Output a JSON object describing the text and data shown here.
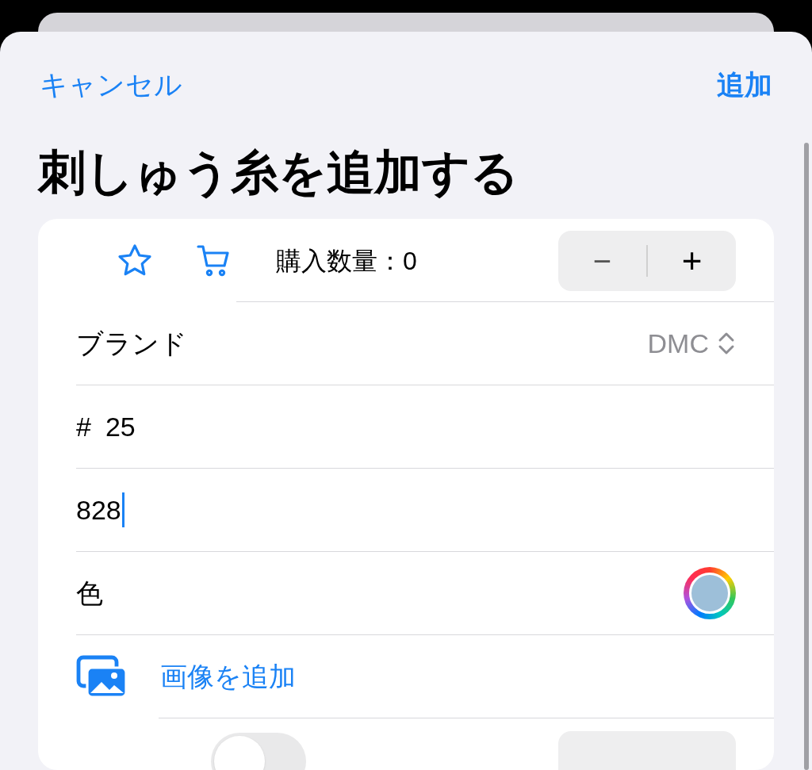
{
  "nav": {
    "cancel": "キャンセル",
    "add": "追加"
  },
  "title": "刺しゅう糸を追加する",
  "purchase": {
    "favorite": false,
    "label": "購入数量：0",
    "minus": "−",
    "plus": "+"
  },
  "brand": {
    "label": "ブランド",
    "value": "DMC"
  },
  "number": {
    "prefix": "#",
    "value": "25"
  },
  "code": {
    "value": "828"
  },
  "color": {
    "label": "色",
    "color": "#9dbfd9"
  },
  "image": {
    "label": "画像を追加"
  },
  "stock": {
    "on": false
  }
}
